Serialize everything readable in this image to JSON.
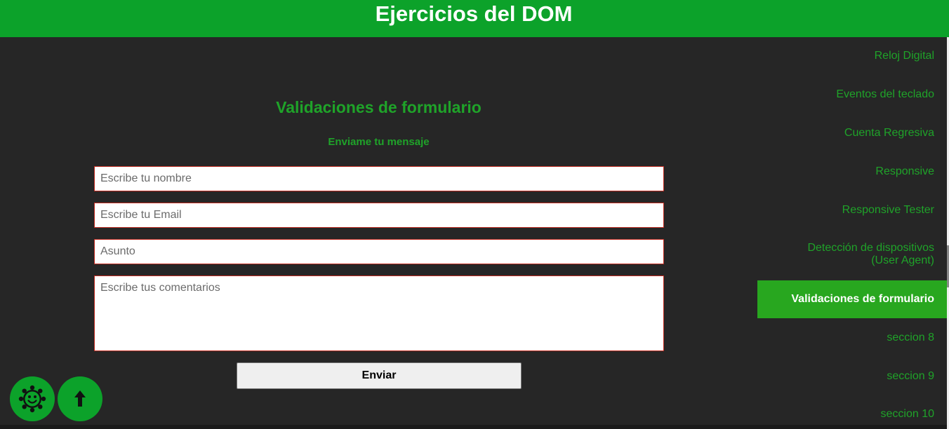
{
  "header": {
    "title": "Ejercicios del DOM"
  },
  "main": {
    "section_title": "Validaciones de formulario",
    "form": {
      "subtitle": "Enviame tu mensaje",
      "name_placeholder": "Escribe tu nombre",
      "email_placeholder": "Escribe tu Email",
      "subject_placeholder": "Asunto",
      "comments_placeholder": "Escribe tus comentarios",
      "submit_label": "Enviar"
    }
  },
  "sidebar": {
    "items": [
      {
        "label": "Reloj Digital"
      },
      {
        "label": "Eventos del teclado"
      },
      {
        "label": "Cuenta Regresiva"
      },
      {
        "label": "Responsive"
      },
      {
        "label": "Responsive Tester"
      },
      {
        "label": "Detección de dispositivos",
        "label2": "(User Agent)"
      },
      {
        "label": "Validaciones de formulario",
        "active": true
      },
      {
        "label": "seccion 8"
      },
      {
        "label": "seccion 9"
      },
      {
        "label": "seccion 10"
      }
    ]
  },
  "floating_buttons": {
    "theme_icon": "sun-face-icon",
    "scroll_top_icon": "arrow-up-icon"
  },
  "colors": {
    "brand_green": "#0ca22a",
    "text_green": "#1fa329",
    "background": "#262626",
    "input_border": "#c02a1f"
  }
}
